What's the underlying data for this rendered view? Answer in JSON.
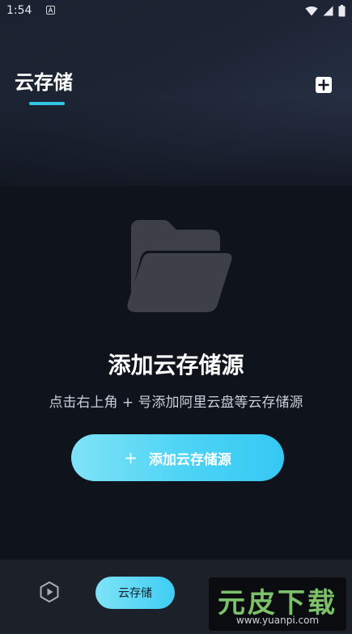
{
  "status_bar": {
    "time": "1:54"
  },
  "header": {
    "title": "云存储",
    "add_icon": "plus-square-icon"
  },
  "empty_state": {
    "icon": "folder-open-icon",
    "title": "添加云存储源",
    "description": "点击右上角 + 号添加阿里云盘等云存储源",
    "button_plus": "+",
    "button_label": "添加云存储源"
  },
  "bottom_nav": {
    "play_icon": "play-icon",
    "active_tab_label": "云存储"
  },
  "watermark": {
    "text": "元皮下载",
    "url": "www.yuanpi.com"
  },
  "colors": {
    "accent": "#2fc7e4",
    "button_start": "#7fe3f7",
    "button_end": "#35c8f4",
    "background": "#0f131b",
    "nav_bg": "#1c2029"
  }
}
